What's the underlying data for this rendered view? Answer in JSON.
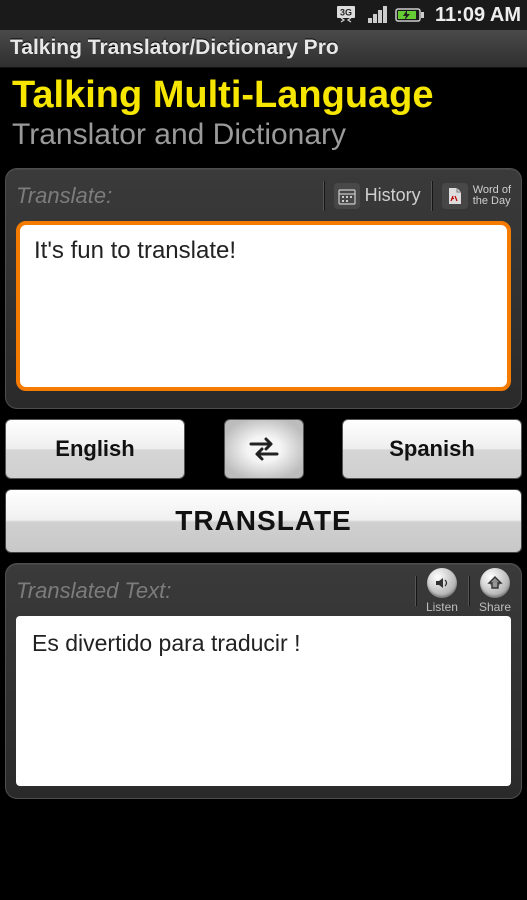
{
  "status": {
    "time": "11:09 AM"
  },
  "app": {
    "title": "Talking Translator/Dictionary Pro",
    "heading": "Talking Multi-Language",
    "subheading": "Translator and Dictionary"
  },
  "translate_panel": {
    "label": "Translate:",
    "history_label": "History",
    "wotd_line1": "Word of",
    "wotd_line2": "the Day",
    "input_text": "It's fun to translate!"
  },
  "languages": {
    "source": "English",
    "target": "Spanish"
  },
  "buttons": {
    "translate": "TRANSLATE"
  },
  "output_panel": {
    "label": "Translated Text:",
    "listen_label": "Listen",
    "share_label": "Share",
    "output_text": "Es divertido para traducir !"
  }
}
